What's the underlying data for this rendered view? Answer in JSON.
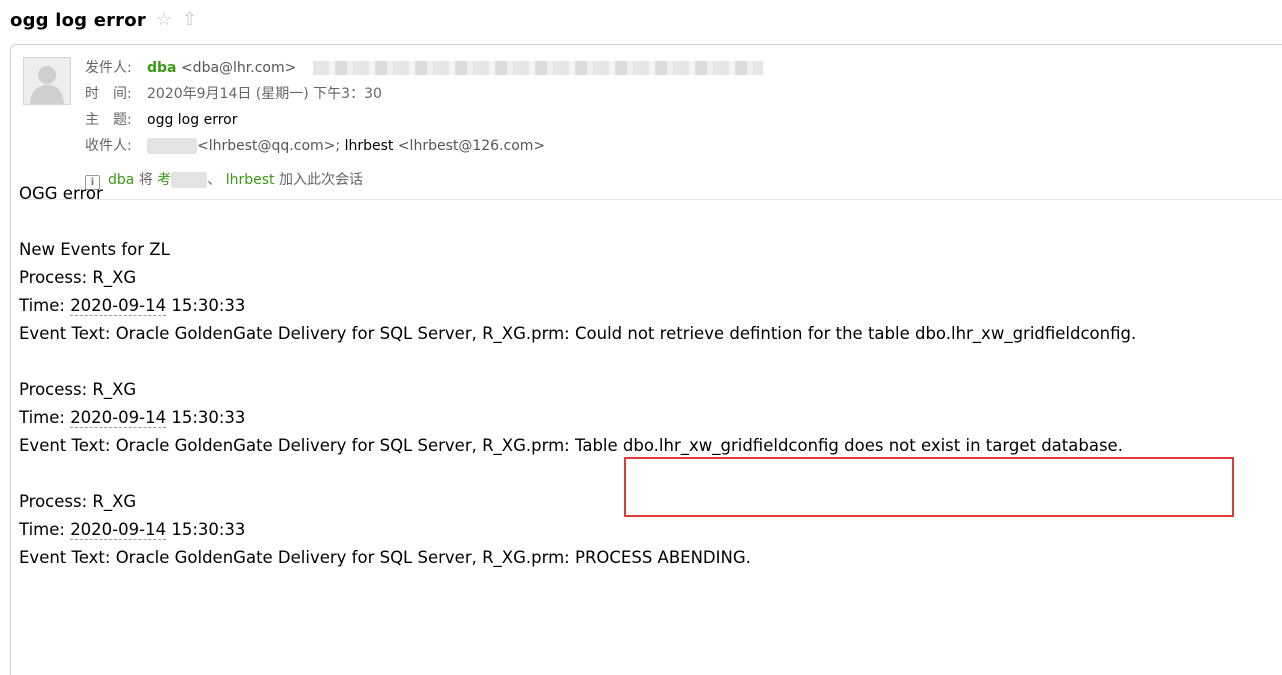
{
  "header": {
    "title": "ogg log error",
    "star_icon": "☆",
    "share_icon": "⇧"
  },
  "email": {
    "from_label": "发件人:",
    "from_name": "dba",
    "from_addr": "<dba@lhr.com>",
    "time_label": "时　间:",
    "time_value": "2020年9月14日 (星期一) 下午3：30",
    "subject_label": "主　题:",
    "subject_value": "ogg log error",
    "to_label": "收件人:",
    "to_first": "<lhrbest@qq.com>;",
    "to_second_name": "lhrbest",
    "to_second_addr": "<lhrbest@126.com>",
    "notice_icon": "i",
    "notice_who": "dba",
    "notice_will": "将",
    "notice_partial": "考",
    "notice_sep": "、",
    "notice_name": "lhrbest",
    "notice_tail": "加入此次会话"
  },
  "body": {
    "greeting": "OGG error",
    "section_title": "New Events for ZL",
    "events": [
      {
        "process_label": "Process: ",
        "process": "R_XG",
        "time_label": "Time: ",
        "date": "2020-09-14",
        "clock": " 15:30:33",
        "text_prefix": "Event Text: Oracle GoldenGate Delivery for SQL Server, R_XG.prm: ",
        "text_body": " Could not retrieve defintion for the table dbo.lhr_xw_gridfieldconfig."
      },
      {
        "process_label": "Process: ",
        "process": "R_XG",
        "time_label": "Time: ",
        "date": "2020-09-14",
        "clock": " 15:30:33",
        "text_prefix": "Event Text: Oracle GoldenGate Delivery for SQL Server, R_XG.prm: ",
        "text_body": " Table dbo.lhr_xw_gridfieldconfig does not exist in target database."
      },
      {
        "process_label": "Process: ",
        "process": "R_XG",
        "time_label": "Time: ",
        "date": "2020-09-14",
        "clock": " 15:30:33",
        "text_prefix": "Event Text: Oracle GoldenGate Delivery for SQL Server, R_XG.prm: ",
        "text_body": " PROCESS ABENDING."
      }
    ]
  },
  "colors": {
    "sender_green": "#3a9a14",
    "highlight_red": "#e03b3b"
  }
}
